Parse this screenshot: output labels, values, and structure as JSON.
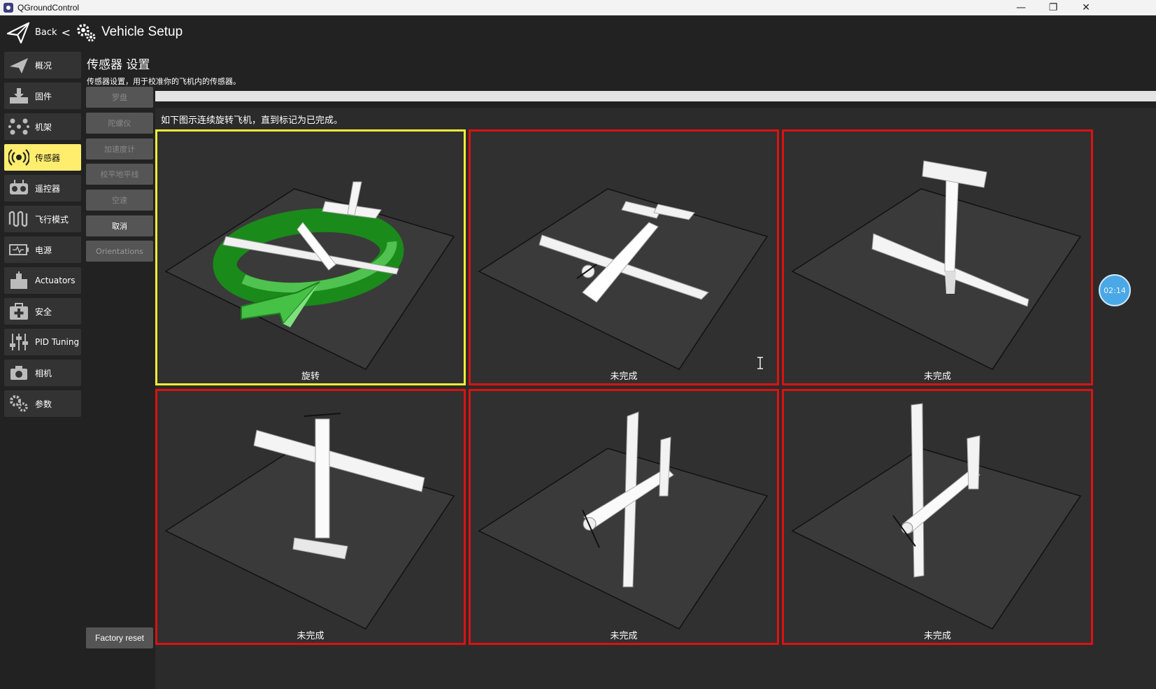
{
  "window": {
    "title": "QGroundControl"
  },
  "toolbar": {
    "back_label": "Back",
    "separator": "<",
    "title": "Vehicle Setup"
  },
  "sidebar": {
    "items": [
      {
        "label": "概况",
        "icon": "paper-plane-icon",
        "active": false
      },
      {
        "label": "固件",
        "icon": "firmware-download-icon",
        "active": false
      },
      {
        "label": "机架",
        "icon": "airframe-dots-icon",
        "active": false
      },
      {
        "label": "传感器",
        "icon": "sensors-radio-icon",
        "active": true
      },
      {
        "label": "遥控器",
        "icon": "radio-controller-icon",
        "active": false
      },
      {
        "label": "飞行模式",
        "icon": "flight-modes-wave-icon",
        "active": false
      },
      {
        "label": "电源",
        "icon": "power-battery-icon",
        "active": false
      },
      {
        "label": "Actuators",
        "icon": "actuators-icon",
        "active": false
      },
      {
        "label": "安全",
        "icon": "safety-medkit-icon",
        "active": false
      },
      {
        "label": "PID Tuning",
        "icon": "pid-sliders-icon",
        "active": false
      },
      {
        "label": "相机",
        "icon": "camera-icon",
        "active": false
      },
      {
        "label": "参数",
        "icon": "parameters-gears-icon",
        "active": false
      }
    ]
  },
  "main": {
    "heading": "传感器 设置",
    "description": "传感器设置，用于校准你的飞机内的传感器。",
    "sensor_buttons": [
      {
        "label": "罗盘",
        "enabled": false
      },
      {
        "label": "陀螺仪",
        "enabled": false
      },
      {
        "label": "加速度计",
        "enabled": false
      },
      {
        "label": "校平地平线",
        "enabled": false
      },
      {
        "label": "空速",
        "enabled": false
      },
      {
        "label": "取消",
        "enabled": true
      },
      {
        "label": "Orientations",
        "enabled": false
      }
    ],
    "factory_reset": "Factory reset",
    "progress": 1.0,
    "instruction": "如下图示连续旋转飞机，直到标记为已完成。",
    "orientations": [
      {
        "status": "旋转",
        "state": "active"
      },
      {
        "status": "未完成",
        "state": "incomplete"
      },
      {
        "status": "未完成",
        "state": "incomplete"
      },
      {
        "status": "未完成",
        "state": "incomplete"
      },
      {
        "status": "未完成",
        "state": "incomplete"
      },
      {
        "status": "未完成",
        "state": "incomplete"
      }
    ],
    "timer": "02:14"
  },
  "colors": {
    "active_yellow": "#ffee6e",
    "active_border": "#f4ee33",
    "incomplete_border": "#dd1111",
    "accent_blue": "#4aa8e6"
  }
}
